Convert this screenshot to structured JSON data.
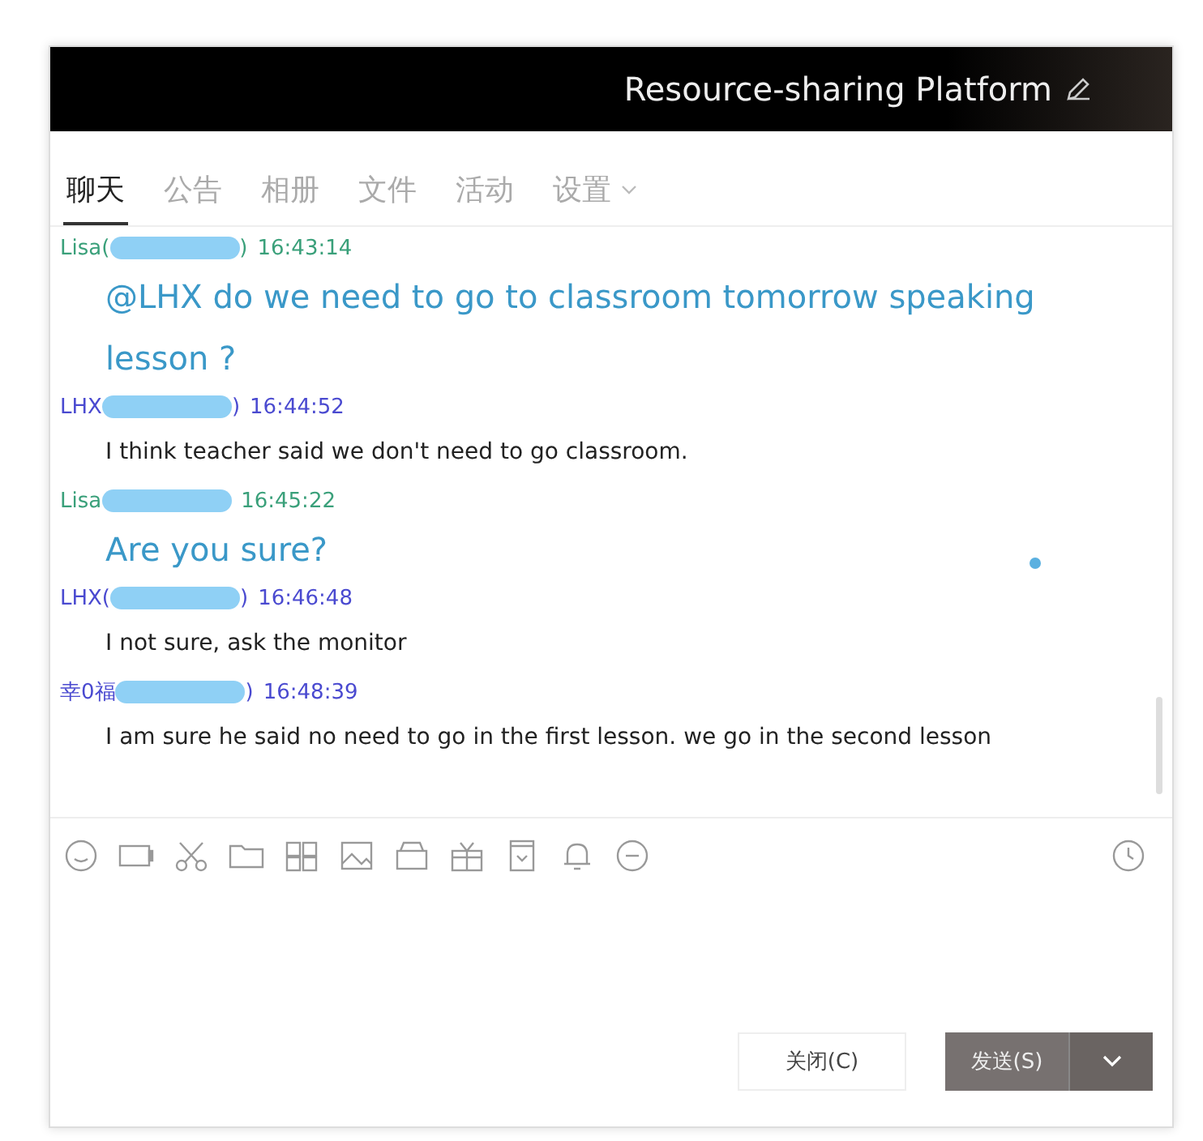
{
  "window": {
    "title": "Resource-sharing Platform"
  },
  "tabs": [
    {
      "label": "聊天",
      "selected": true,
      "dropdown": false
    },
    {
      "label": "公告",
      "selected": false,
      "dropdown": false
    },
    {
      "label": "相册",
      "selected": false,
      "dropdown": false
    },
    {
      "label": "文件",
      "selected": false,
      "dropdown": false
    },
    {
      "label": "活动",
      "selected": false,
      "dropdown": false
    },
    {
      "label": "设置",
      "selected": false,
      "dropdown": true
    }
  ],
  "messages": [
    {
      "sender": "Lisa(",
      "sender_end": ")",
      "time": "16:43:14",
      "color": "#3aa07a",
      "kind": "large",
      "text": "@LHX do we need to go to classroom tomorrow speaking lesson ?"
    },
    {
      "sender": "LHX",
      "sender_end": ")",
      "time": "16:44:52",
      "color": "#4a4ad0",
      "kind": "normal",
      "text": "I think teacher said we don't need to go classroom."
    },
    {
      "sender": "Lisa",
      "time": "16:45:22",
      "color": "#3aa07a",
      "kind": "large",
      "text": "Are you sure?"
    },
    {
      "sender": "LHX(",
      "sender_end": ")",
      "time": "16:46:48",
      "color": "#4a4ad0",
      "kind": "normal",
      "text": "I not sure, ask the monitor"
    },
    {
      "sender": "幸0福",
      "sender_end": ")",
      "time": "16:48:39",
      "color": "#4a4ad0",
      "kind": "normal",
      "text": "I am sure he said no need to go in the first lesson. we go in the second lesson"
    }
  ],
  "buttons": [
    {
      "label": "关闭(C)",
      "kind": "secondary"
    },
    {
      "label": "发送(S)",
      "kind": "primary"
    }
  ]
}
